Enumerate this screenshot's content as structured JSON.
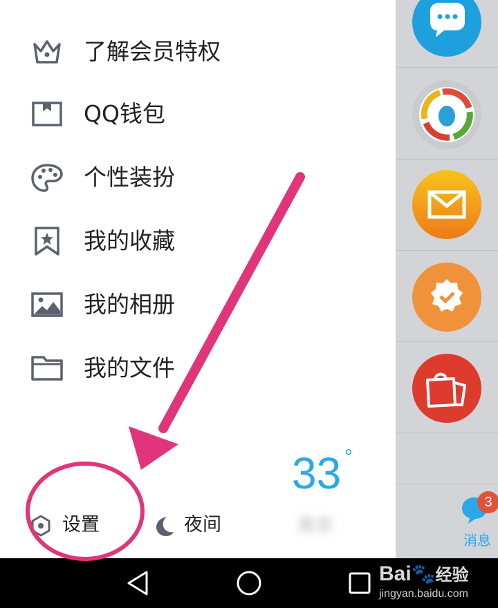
{
  "menu": {
    "items": [
      {
        "label": "了解会员特权",
        "icon": "crown-icon"
      },
      {
        "label": "QQ钱包",
        "icon": "wallet-icon"
      },
      {
        "label": "个性装扮",
        "icon": "palette-icon"
      },
      {
        "label": "我的收藏",
        "icon": "bookmark-star-icon"
      },
      {
        "label": "我的相册",
        "icon": "photo-icon"
      },
      {
        "label": "我的文件",
        "icon": "folder-icon"
      }
    ]
  },
  "bottom": {
    "settings_label": "设置",
    "night_label": "夜间"
  },
  "weather": {
    "temperature": "33",
    "degree": "°",
    "city": "南京"
  },
  "tabbar": {
    "messages_label": "消息",
    "messages_badge": "3"
  },
  "watermark": {
    "logo": "Bai",
    "logo_suffix": "经验",
    "url": "jingyan.baidu.com"
  },
  "colors": {
    "accent": "#29a9e8",
    "annotation": "#e0357a",
    "menu_icon": "#5b6170",
    "badge": "#e0523a"
  },
  "right_panel_icons": [
    "chat-bubble-icon",
    "qq-tencent-icon",
    "mail-icon",
    "badge-check-icon",
    "shopping-bag-icon"
  ]
}
